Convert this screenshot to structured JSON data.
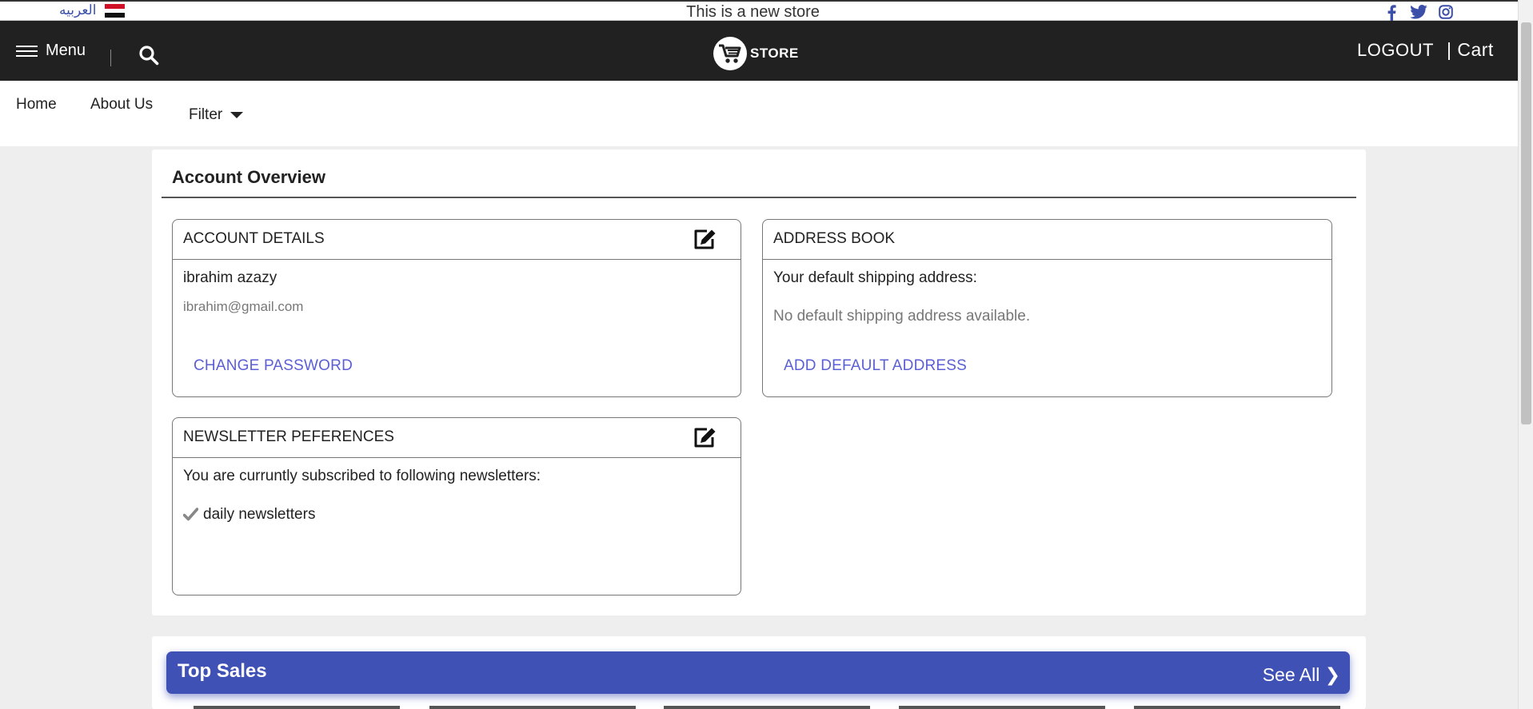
{
  "topbar": {
    "language_link": "العربيه",
    "announcement": "This is a new store",
    "social": [
      "facebook-icon",
      "twitter-icon",
      "instagram-icon"
    ]
  },
  "header": {
    "menu_label": "Menu",
    "logo_text": "STORE",
    "logout_label": "LOGOUT",
    "cart_label": "| Cart"
  },
  "nav": {
    "home": "Home",
    "about": "About Us",
    "filter": "Filter"
  },
  "account": {
    "title": "Account Overview",
    "details": {
      "title": "ACCOUNT DETAILS",
      "name": "ibrahim azazy",
      "email": "ibrahim@gmail.com",
      "change_password": "CHANGE PASSWORD"
    },
    "address_book": {
      "title": "ADDRESS BOOK",
      "default_label": "Your default shipping address:",
      "empty_message": "No default shipping address available.",
      "add_link": "ADD DEFAULT ADDRESS"
    },
    "newsletter": {
      "title": "NEWSLETTER PEFERENCES",
      "subscribed_label": "You are curruntly subscribed to following newsletters:",
      "items": [
        "daily newsletters"
      ]
    }
  },
  "top_sales": {
    "title": "Top Sales",
    "see_all": "See All ❯"
  },
  "colors": {
    "header_bg": "#212121",
    "accent": "#3f51b5",
    "link": "#5b5fd4",
    "page_bg": "#eeeeee"
  }
}
